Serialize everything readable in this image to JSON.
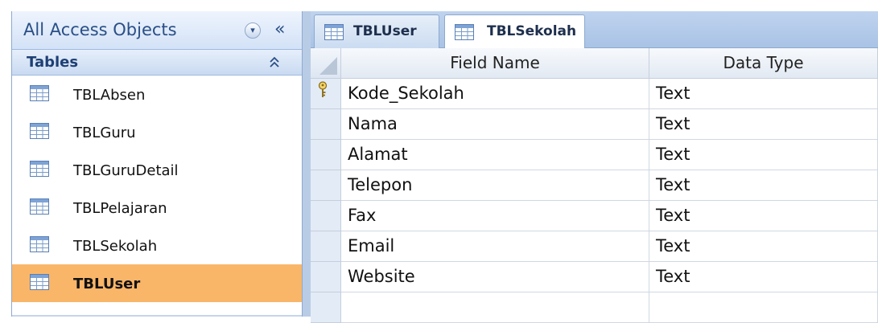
{
  "nav": {
    "title": "All Access Objects",
    "dropdown_glyph": "▾",
    "collapse_glyph": "«",
    "group": {
      "label": "Tables",
      "chevron_glyph": "≈"
    },
    "items": [
      {
        "label": "TBLAbsen",
        "icon": "table-icon"
      },
      {
        "label": "TBLGuru",
        "icon": "table-icon"
      },
      {
        "label": "TBLGuruDetail",
        "icon": "table-icon"
      },
      {
        "label": "TBLPelajaran",
        "icon": "table-icon"
      },
      {
        "label": "TBLSekolah",
        "icon": "table-icon"
      },
      {
        "label": "TBLUser",
        "icon": "table-icon",
        "selected": true
      }
    ]
  },
  "tabs": [
    {
      "label": "TBLUser",
      "active": false
    },
    {
      "label": "TBLSekolah",
      "active": true
    }
  ],
  "grid": {
    "headers": {
      "field": "Field Name",
      "type": "Data Type"
    },
    "rows": [
      {
        "field": "Kode_Sekolah",
        "type": "Text",
        "primary_key": true
      },
      {
        "field": "Nama",
        "type": "Text"
      },
      {
        "field": "Alamat",
        "type": "Text"
      },
      {
        "field": "Telepon",
        "type": "Text"
      },
      {
        "field": "Fax",
        "type": "Text"
      },
      {
        "field": "Email",
        "type": "Text"
      },
      {
        "field": "Website",
        "type": "Text"
      },
      {
        "field": "",
        "type": ""
      }
    ]
  },
  "colors": {
    "selected_item": "#f9b669",
    "nav_text": "#2a4f86",
    "pane_header": "#d3e2f7"
  }
}
